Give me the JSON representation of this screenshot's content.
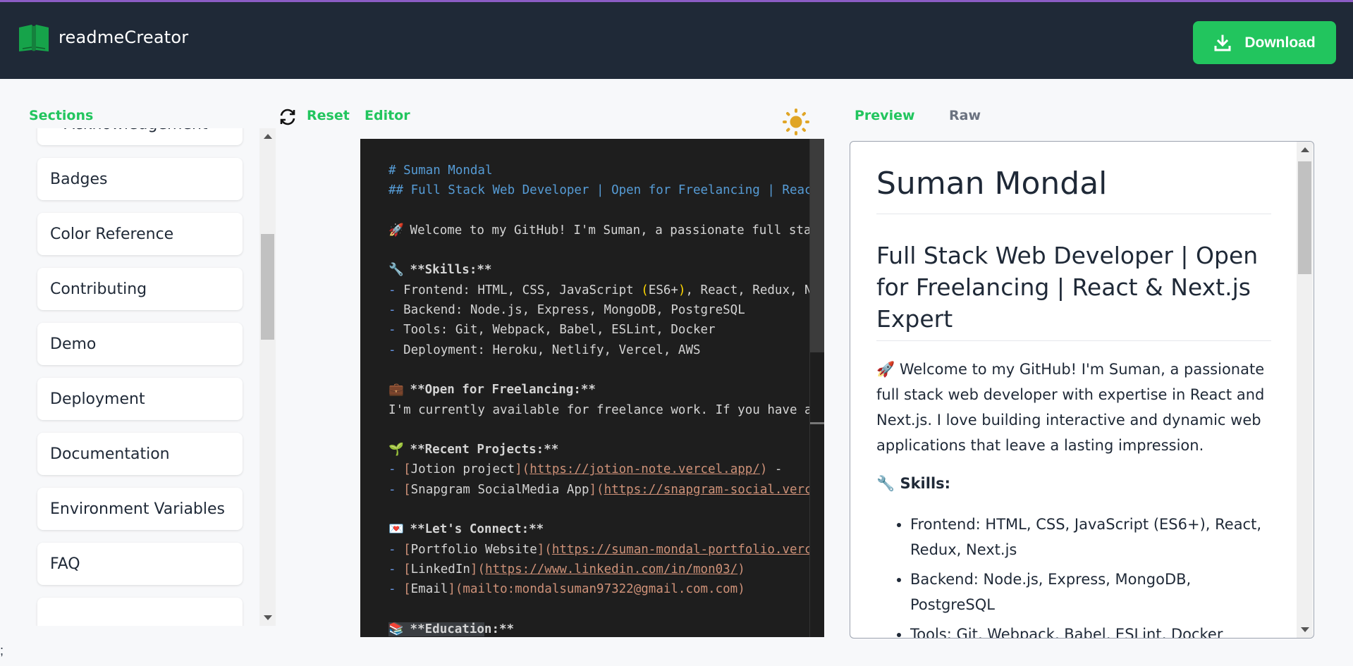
{
  "header": {
    "app_title": "readmeCreator",
    "logo_icon": "book-open-icon",
    "download_label": "Download",
    "download_icon": "download-icon",
    "accent_color": "#22c55e",
    "background_color": "#1f2937"
  },
  "sidebar": {
    "label": "Sections",
    "items": [
      {
        "label": "Acknowledgement"
      },
      {
        "label": "Badges"
      },
      {
        "label": "Color Reference"
      },
      {
        "label": "Contributing"
      },
      {
        "label": "Demo"
      },
      {
        "label": "Deployment"
      },
      {
        "label": "Documentation"
      },
      {
        "label": "Environment Variables"
      },
      {
        "label": "FAQ"
      },
      {
        "label": ""
      }
    ]
  },
  "editor": {
    "reset_label": "Reset",
    "reset_icon": "refresh-icon",
    "label": "Editor",
    "theme_icon": "sun-icon",
    "lines": {
      "l1": "# Suman Mondal",
      "l2": "## Full Stack Web Developer | Open for Freelancing | React & Next.js Expert",
      "l4_emoji": "🚀",
      "l4": "Welcome to my GitHub! I'm Suman, a passionate full stack web developer with expertise in React and Next.js.",
      "l6_emoji": "🔧",
      "l6": "**Skills:**",
      "l7a": "Frontend: HTML, CSS, JavaScript ",
      "l7b": "(",
      "l7c": "ES6+",
      "l7d": ")",
      "l7e": ", React, Redux, Next.js",
      "l8": "Backend: Node.js, Express, MongoDB, PostgreSQL",
      "l9": "Tools: Git, Webpack, Babel, ESLint, Docker",
      "l10": "Deployment: Heroku, Netlify, Vercel, AWS",
      "l12_emoji": "💼",
      "l12": "**Open for Freelancing:**",
      "l13": "I'm currently available for freelance work. If you have a project in mind, let's talk!",
      "l15_emoji": "🌱",
      "l15": "**Recent Projects:**",
      "l16_text": "Jotion project",
      "l16_url": "https://jotion-note.vercel.app/",
      "l16_tail": " - ",
      "l17_text": "Snapgram SocialMedia App",
      "l17_url": "https://snapgram-social.vercel.app/",
      "l19_emoji": "💌",
      "l19": "**Let's Connect:**",
      "l20_text": "Portfolio Website",
      "l20_url": "https://suman-mondal-portfolio.vercel.app/",
      "l21_text": "LinkedIn",
      "l21_url": "https://www.linkedin.com/in/mon03/",
      "l22_text": "Email",
      "l22_url": "mailto:mondalsuman97322@gmail.com.com",
      "l24_emoji": "📚",
      "l24a": "**Educatio",
      "l24b": "n:**",
      "dash": "- ",
      "lb": "[",
      "rb": "](",
      "rp": ")"
    }
  },
  "preview": {
    "tab_preview": "Preview",
    "tab_raw": "Raw",
    "h1": "Suman Mondal",
    "h2": "Full Stack Web Developer | Open for Freelancing | React & Next.js Expert",
    "intro_emoji": "🚀",
    "intro": "Welcome to my GitHub! I'm Suman, a passionate full stack web developer with expertise in React and Next.js. I love building interactive and dynamic web applications that leave a lasting impression.",
    "skills_emoji": "🔧",
    "skills_heading": "Skills:",
    "skills": [
      "Frontend: HTML, CSS, JavaScript (ES6+), React, Redux, Next.js",
      "Backend: Node.js, Express, MongoDB, PostgreSQL",
      "Tools: Git, Webpack, Babel, ESLint, Docker"
    ]
  },
  "misc": {
    "stray_glyph": ";"
  }
}
